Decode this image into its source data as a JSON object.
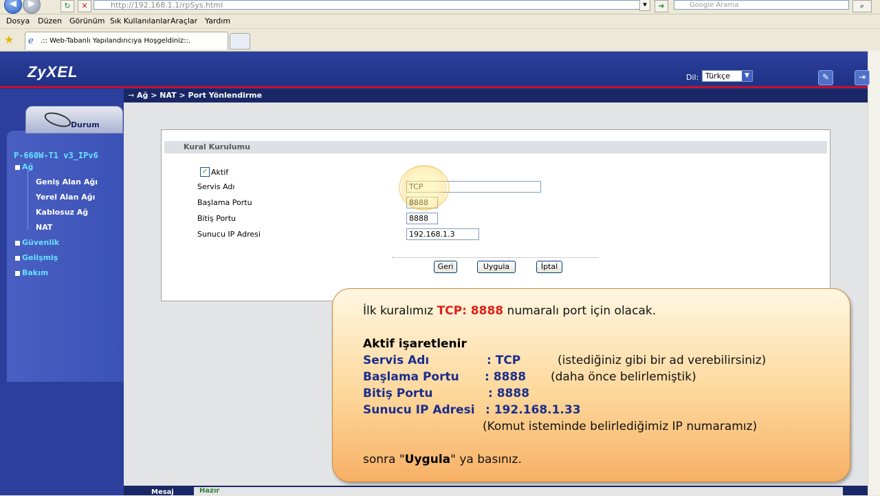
{
  "browser": {
    "url": "http://192.168.1.1/rpSys.html",
    "search_placeholder": "Google Arama",
    "menu": [
      "Dosya",
      "Düzen",
      "Görünüm",
      "Sık Kullanılanlar",
      "Araçlar",
      "Yardım"
    ],
    "tab_title": ".:: Web-Tabanlı Yapılandırıcıya Hoşgeldiniz::."
  },
  "header": {
    "logo": "ZyXEL",
    "lang_label": "Dil:",
    "lang_value": "Türkçe"
  },
  "breadcrumb": "Ağ > NAT > Port Yönlendirme",
  "sidebar": {
    "durum": "Durum",
    "device": "P-660W-T1 v3_IPv6",
    "ag": "Ağ",
    "ag_items": [
      "Geniş Alan Ağı",
      "Yerel Alan Ağı",
      "Kablosuz Ağ",
      "NAT"
    ],
    "guvenlik": "Güvenlik",
    "gelismis": "Gelişmiş",
    "bakim": "Bakım"
  },
  "form": {
    "title": "Kural Kurulumu",
    "aktif_label": "Aktif",
    "aktif_checked": "✓",
    "servis_label": "Servis Adı",
    "servis_value": "TCP",
    "baslama_label": "Başlama Portu",
    "baslama_value": "8888",
    "bitis_label": "Bitiş Portu",
    "bitis_value": "8888",
    "ip_label": "Sunucu IP Adresi",
    "ip_value": "192.168.1.3",
    "geri": "Geri",
    "uygula": "Uygula",
    "iptal": "İptal"
  },
  "status": {
    "mesaj": "Mesaj",
    "hazir": "Hazır"
  },
  "callout": {
    "l1_pre": "İlk kuralımız",
    "l1_red": "TCP: 8888",
    "l1_post": "numaralı port için olacak.",
    "l2": "Aktif işaretlenir",
    "r1_label": "Servis Adı",
    "r1_value": ": TCP",
    "r1_note": "(istediğiniz gibi bir ad verebilirsiniz)",
    "r2_label": "Başlama Portu",
    "r2_value": ": 8888",
    "r2_note": "(daha önce belirlemiştik)",
    "r3_label": "Bitiş Portu",
    "r3_value": ": 8888",
    "r4_label": "Sunucu IP Adresi",
    "r4_value": ": 192.168.1.33",
    "r4_note": "(Komut isteminde belirlediğimiz IP numaramız)",
    "last_pre": "sonra \"",
    "last_bold": "Uygula",
    "last_post": "\" ya basınız."
  }
}
